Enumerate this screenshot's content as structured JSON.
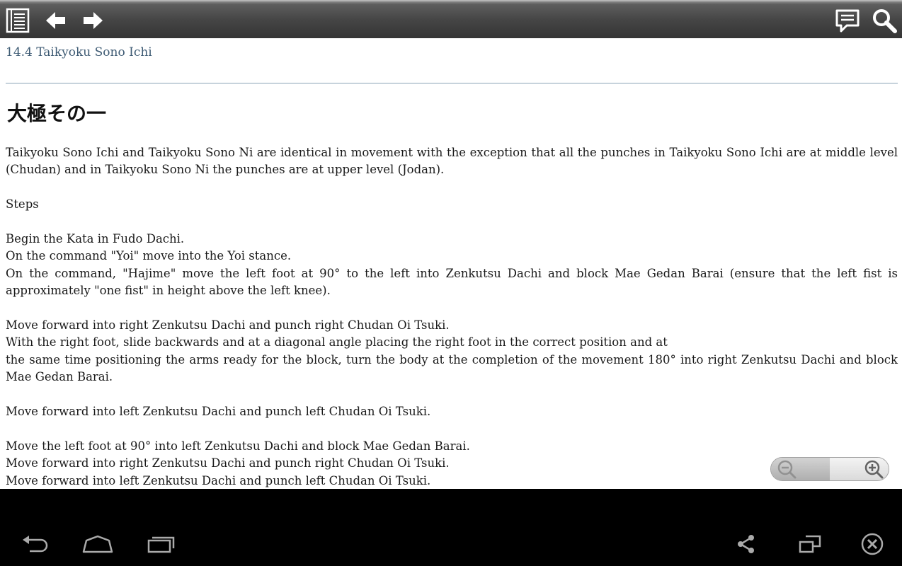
{
  "toolbar": {
    "icons": [
      "toc-icon",
      "back-arrow-icon",
      "forward-arrow-icon",
      "comment-icon",
      "search-icon"
    ]
  },
  "chapter": {
    "title": "14.4 Taikyoku Sono Ichi"
  },
  "heading_jp": "大極その一",
  "body": {
    "p1": "Taikyoku Sono Ichi and Taikyoku Sono Ni are identical in movement with the exception that all the punches in Taikyoku Sono Ichi are at middle level (Chudan) and in Taikyoku Sono Ni the punches are at upper level (Jodan).",
    "steps": "Steps",
    "l1": "Begin the Kata in Fudo Dachi.",
    "l2": "On the command \"Yoi\" move into the Yoi stance.",
    "l3": "On the command, \"Hajime\" move the left foot at 90° to the left into Zenkutsu Dachi and block Mae Gedan Barai (ensure that the left fist is approximately \"one fist\" in height above the left knee).",
    "l4": "Move forward into right Zenkutsu Dachi and punch right Chudan Oi Tsuki.",
    "l5": "With the right foot, slide backwards and at a diagonal angle placing the right foot in the correct position and at",
    "l6": "the same time positioning the arms ready for the block, turn the body at the completion of the movement 180° into right Zenkutsu Dachi and block Mae Gedan Barai.",
    "l7": "Move forward into left Zenkutsu Dachi and punch left Chudan Oi Tsuki.",
    "l8": "Move the left foot at 90° into left Zenkutsu Dachi and block Mae Gedan Barai.",
    "l9": "Move forward into right Zenkutsu Dachi and punch right Chudan Oi Tsuki.",
    "l10": "Move forward into left Zenkutsu Dachi and punch left Chudan Oi Tsuki."
  },
  "zoom": {
    "icons": [
      "zoom-out-icon",
      "zoom-in-icon"
    ]
  },
  "navbar": {
    "icons": [
      "back-icon",
      "home-icon",
      "recent-apps-icon",
      "share-icon",
      "resize-icon",
      "close-icon"
    ]
  }
}
